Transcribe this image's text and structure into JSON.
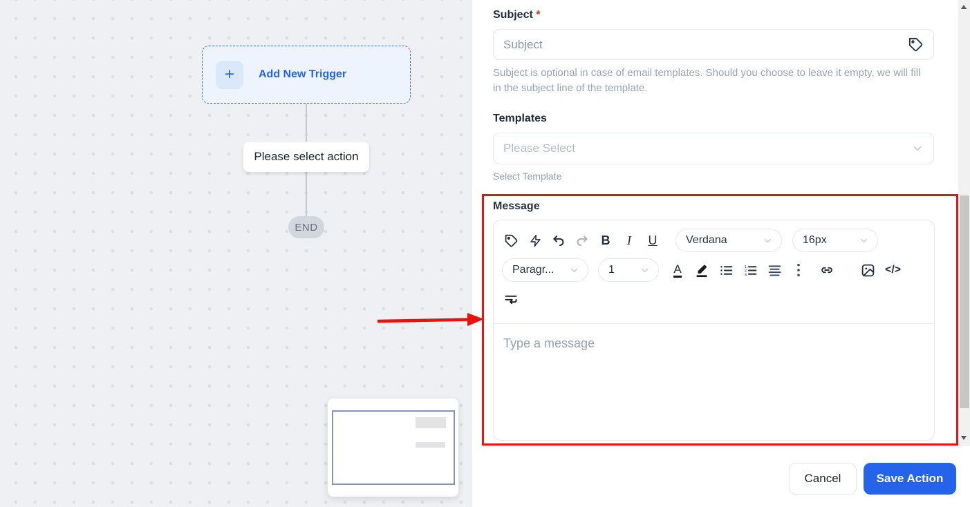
{
  "canvas": {
    "trigger": {
      "plus": "+",
      "label": "Add New Trigger"
    },
    "action_hint": "Please select action",
    "end_label": "END"
  },
  "panel": {
    "subject": {
      "label": "Subject",
      "required_mark": "*",
      "placeholder": "Subject",
      "helper": "Subject is optional in case of email templates. Should you choose to leave it empty, we will fill in the subject line of the template."
    },
    "templates": {
      "label": "Templates",
      "placeholder": "Please Select",
      "helper": "Select Template"
    },
    "message": {
      "label": "Message",
      "toolbar": {
        "bold": "B",
        "italic": "I",
        "underline": "U",
        "font_color": "A",
        "code": "</>",
        "font_family_value": "Verdana",
        "font_size_value": "16px",
        "paragraph_value": "Paragr...",
        "depth_value": "1",
        "more_dots": "⋮"
      },
      "placeholder": "Type a message"
    },
    "footer": {
      "cancel": "Cancel",
      "save": "Save Action"
    }
  },
  "colors": {
    "accent_blue": "#2563eb",
    "annotation_red": "#ee0f0f",
    "required_red": "#dc2626",
    "canvas_bg": "#eef0f3"
  }
}
